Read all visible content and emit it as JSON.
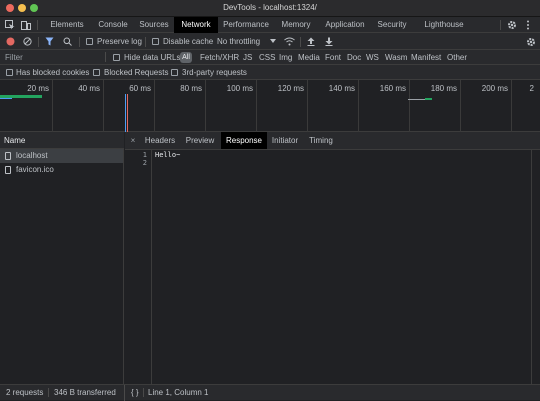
{
  "window": {
    "title": "DevTools - localhost:1324/"
  },
  "main_tabs": [
    "Elements",
    "Console",
    "Sources",
    "Network",
    "Performance",
    "Memory",
    "Application",
    "Security",
    "Lighthouse"
  ],
  "toolbar": {
    "preserve_log": "Preserve log",
    "disable_cache": "Disable cache",
    "throttling": "No throttling"
  },
  "filter": {
    "placeholder": "Filter",
    "hide_data_urls": "Hide data URLs",
    "types": [
      "All",
      "Fetch/XHR",
      "JS",
      "CSS",
      "Img",
      "Media",
      "Font",
      "Doc",
      "WS",
      "Wasm",
      "Manifest",
      "Other"
    ]
  },
  "blockbar": {
    "has_blocked_cookies": "Has blocked cookies",
    "blocked_requests": "Blocked Requests",
    "third_party": "3rd-party requests"
  },
  "timeline": {
    "ticks": [
      "20 ms",
      "40 ms",
      "60 ms",
      "80 ms",
      "100 ms",
      "120 ms",
      "140 ms",
      "160 ms",
      "180 ms",
      "200 ms",
      "2"
    ]
  },
  "requests": {
    "column": "Name",
    "rows": [
      "localhost",
      "favicon.ico"
    ]
  },
  "detail": {
    "close": "×",
    "tabs": [
      "Headers",
      "Preview",
      "Response",
      "Initiator",
      "Timing"
    ],
    "line_numbers": [
      "1",
      "2"
    ],
    "response_body": "Hello~"
  },
  "status": {
    "requests": "2 requests",
    "transferred": "346 B transferred",
    "braces": "{ }",
    "cursor": "Line 1, Column 1"
  },
  "colors": {
    "accent": "#8ab4f8",
    "close_red": "#ed6a5e",
    "minimize_yellow": "#f5bf4f",
    "maximize_green": "#61c554",
    "waterfall_green": "#23a45f",
    "waterfall_blue": "#4f9cf5",
    "record_red": "#e46962"
  }
}
